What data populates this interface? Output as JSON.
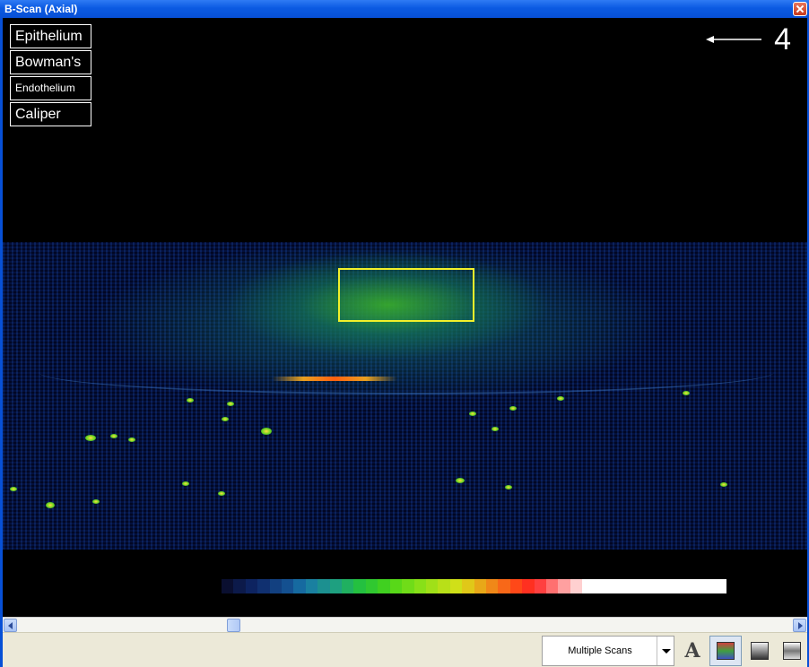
{
  "window": {
    "title": "B-Scan (Axial)"
  },
  "layers": [
    {
      "label": "Epithelium",
      "size": "normal"
    },
    {
      "label": "Bowman's",
      "size": "normal"
    },
    {
      "label": "Endothelium",
      "size": "small"
    },
    {
      "label": "Caliper",
      "size": "normal"
    }
  ],
  "indicator": {
    "number": "4",
    "icon": "left-arrow-icon"
  },
  "roi": {
    "color": "#f2f02a"
  },
  "colorbar": {
    "colors": [
      "#0a0f30",
      "#0c1a4a",
      "#0d2360",
      "#103070",
      "#124080",
      "#145090",
      "#166aa0",
      "#1a80a0",
      "#1c9090",
      "#1ea080",
      "#20b060",
      "#24c040",
      "#30c830",
      "#40d020",
      "#58d818",
      "#70dc18",
      "#88e018",
      "#a0e018",
      "#b8e018",
      "#d0e018",
      "#e0c818",
      "#e8a818",
      "#f08818",
      "#f86818",
      "#ff4818",
      "#ff3020",
      "#ff4040",
      "#ff7070",
      "#ffa0a0",
      "#ffd0d0",
      "#ffffff",
      "#ffffff",
      "#ffffff",
      "#ffffff",
      "#ffffff",
      "#ffffff",
      "#ffffff",
      "#ffffff",
      "#ffffff",
      "#ffffff",
      "#ffffff",
      "#ffffff"
    ]
  },
  "status": {
    "mode_value": "Multiple Scans",
    "tools": [
      {
        "name": "font-tool-button",
        "icon": "font-a-icon",
        "glyph": "A"
      },
      {
        "name": "color-palette-button",
        "icon": "color-palette-icon",
        "active": true
      },
      {
        "name": "grayscale-button",
        "icon": "grayscale-icon"
      },
      {
        "name": "inverted-grayscale-button",
        "icon": "inverted-grayscale-icon"
      }
    ]
  }
}
